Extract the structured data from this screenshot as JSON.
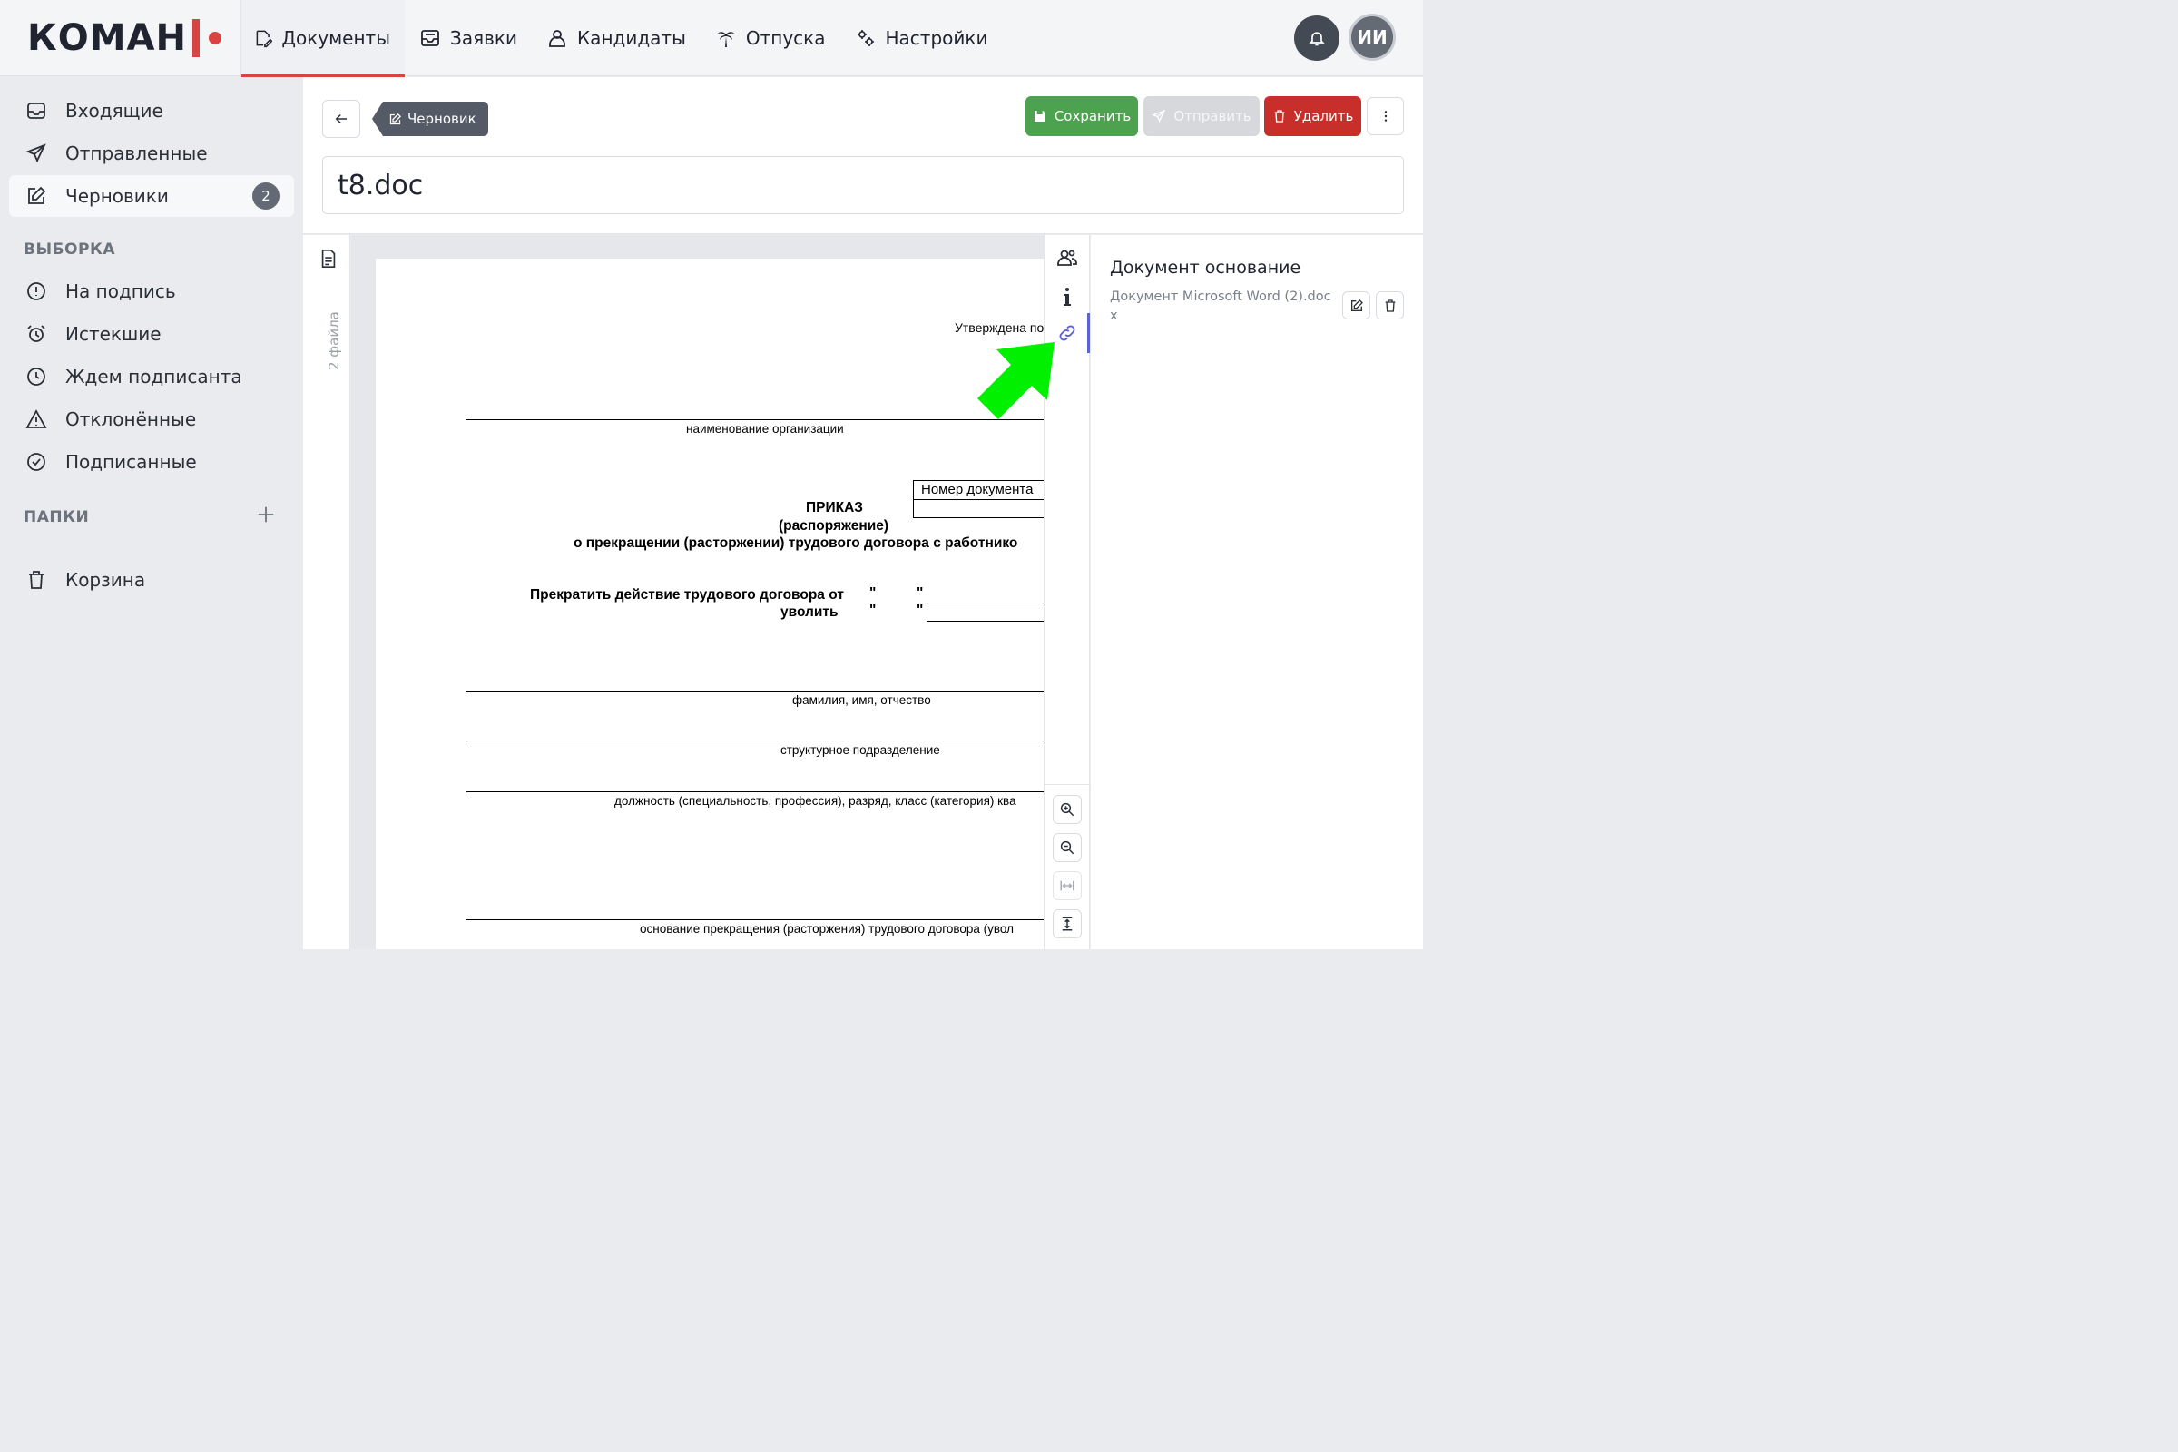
{
  "brand": {
    "logo_text": "КОМАН"
  },
  "nav": {
    "items": [
      {
        "label": "Документы",
        "icon": "document-edit-icon"
      },
      {
        "label": "Заявки",
        "icon": "inbox-tray-icon"
      },
      {
        "label": "Кандидаты",
        "icon": "user-icon"
      },
      {
        "label": "Отпуска",
        "icon": "palm-tree-icon"
      },
      {
        "label": "Настройки",
        "icon": "gears-icon"
      }
    ],
    "avatar_initials": "ИИ"
  },
  "sidebar": {
    "items": [
      {
        "label": "Входящие",
        "icon": "inbox-icon"
      },
      {
        "label": "Отправленные",
        "icon": "paper-plane-icon"
      },
      {
        "label": "Черновики",
        "icon": "edit-icon",
        "badge": "2"
      }
    ],
    "filter_header": "ВЫБОРКА",
    "filters": [
      {
        "label": "На подпись",
        "icon": "exclamation-circle-icon"
      },
      {
        "label": "Истекшие",
        "icon": "alarm-clock-icon"
      },
      {
        "label": "Ждем подписанта",
        "icon": "clock-icon"
      },
      {
        "label": "Отклонённые",
        "icon": "warning-triangle-icon"
      },
      {
        "label": "Подписанные",
        "icon": "check-circle-icon"
      }
    ],
    "folders_header": "ПАПКИ",
    "trash_label": "Корзина"
  },
  "toolbar": {
    "status": "Черновик",
    "save_label": "Сохранить",
    "send_label": "Отправить",
    "delete_label": "Удалить"
  },
  "document": {
    "title": "t8.doc",
    "file_count": "2 файла",
    "approved_text": "Утверждена по",
    "org_caption": "наименование организации",
    "doc_number_label": "Номер документа",
    "order_title": "ПРИКАЗ",
    "order_subtitle": "(распоряжение)",
    "order_heading": "о прекращении (расторжении) трудового договора с работнико",
    "terminate_label": "Прекратить действие трудового договора от",
    "dismiss_label": "уволить",
    "quote_mark": "\"",
    "fio_caption": "фамилия, имя, отчество",
    "dept_caption": "структурное подразделение",
    "position_caption": "должность (специальность, профессия), разряд, класс (категория) ква",
    "reason_caption": "основание прекращения (расторжения) трудового договора (увол"
  },
  "panel": {
    "title": "Документ основание",
    "file_name": "Документ Microsoft Word (2).docx"
  },
  "colors": {
    "accent_red": "#d94343",
    "save_green": "#4da24f",
    "delete_red": "#c92f2a",
    "rail_active": "#5a62d6",
    "annotation_arrow": "#00f000"
  }
}
